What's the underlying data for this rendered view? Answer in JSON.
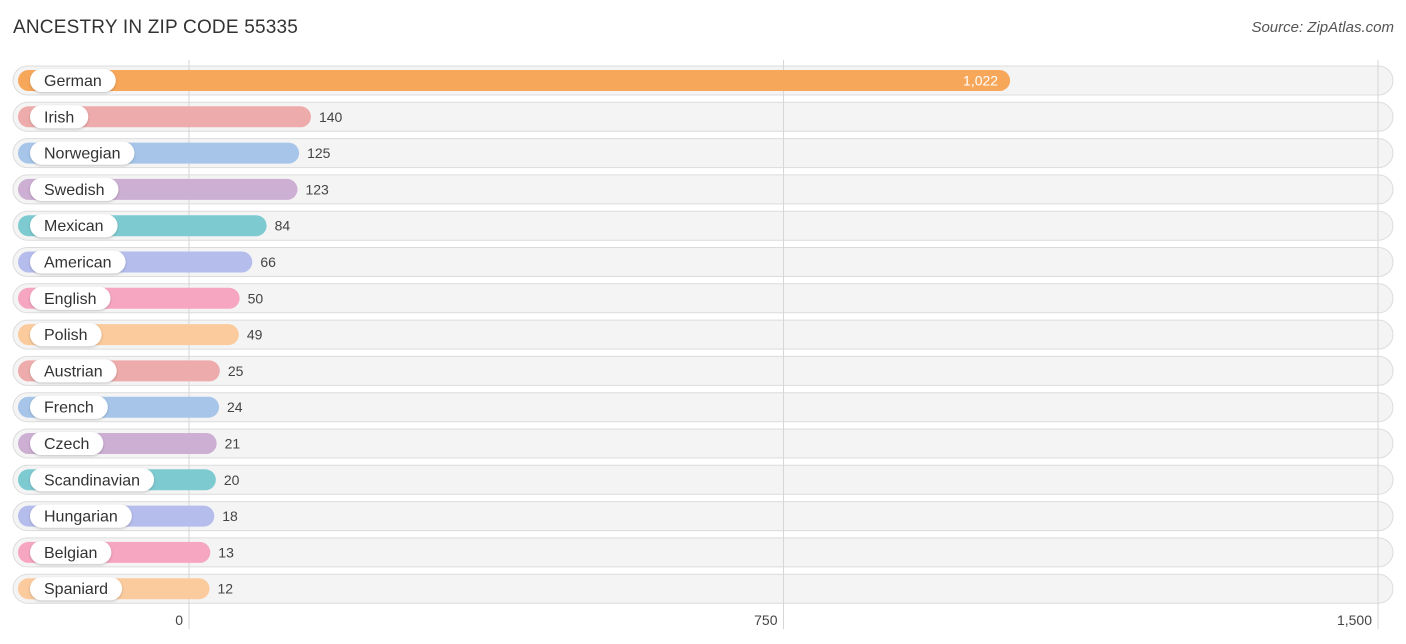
{
  "header": {
    "title": "ANCESTRY IN ZIP CODE 55335",
    "source": "Source: ZipAtlas.com"
  },
  "chart_data": {
    "type": "bar",
    "orientation": "horizontal",
    "title": "ANCESTRY IN ZIP CODE 55335",
    "xlabel": "",
    "ylabel": "",
    "xlim": [
      0,
      1500
    ],
    "grid": true,
    "ticks": [
      {
        "value": 0,
        "label": "0"
      },
      {
        "value": 750,
        "label": "750"
      },
      {
        "value": 1500,
        "label": "1,500"
      }
    ],
    "categories": [
      "German",
      "Irish",
      "Norwegian",
      "Swedish",
      "Mexican",
      "American",
      "English",
      "Polish",
      "Austrian",
      "French",
      "Czech",
      "Scandinavian",
      "Hungarian",
      "Belgian",
      "Spaniard"
    ],
    "values": [
      1022,
      140,
      125,
      123,
      84,
      66,
      50,
      49,
      25,
      24,
      21,
      20,
      18,
      13,
      12
    ],
    "value_labels": [
      "1,022",
      "140",
      "125",
      "123",
      "84",
      "66",
      "50",
      "49",
      "25",
      "24",
      "21",
      "20",
      "18",
      "13",
      "12"
    ],
    "colors": [
      "#f7a75a",
      "#eeabab",
      "#a6c5e9",
      "#ccafd3",
      "#7dcbd1",
      "#b4bdec",
      "#f6a6c1",
      "#fbcb9d",
      "#eeabab",
      "#a6c5e9",
      "#ccafd3",
      "#7dcbd1",
      "#b4bdec",
      "#f6a6c1",
      "#fbcb9d"
    ]
  }
}
